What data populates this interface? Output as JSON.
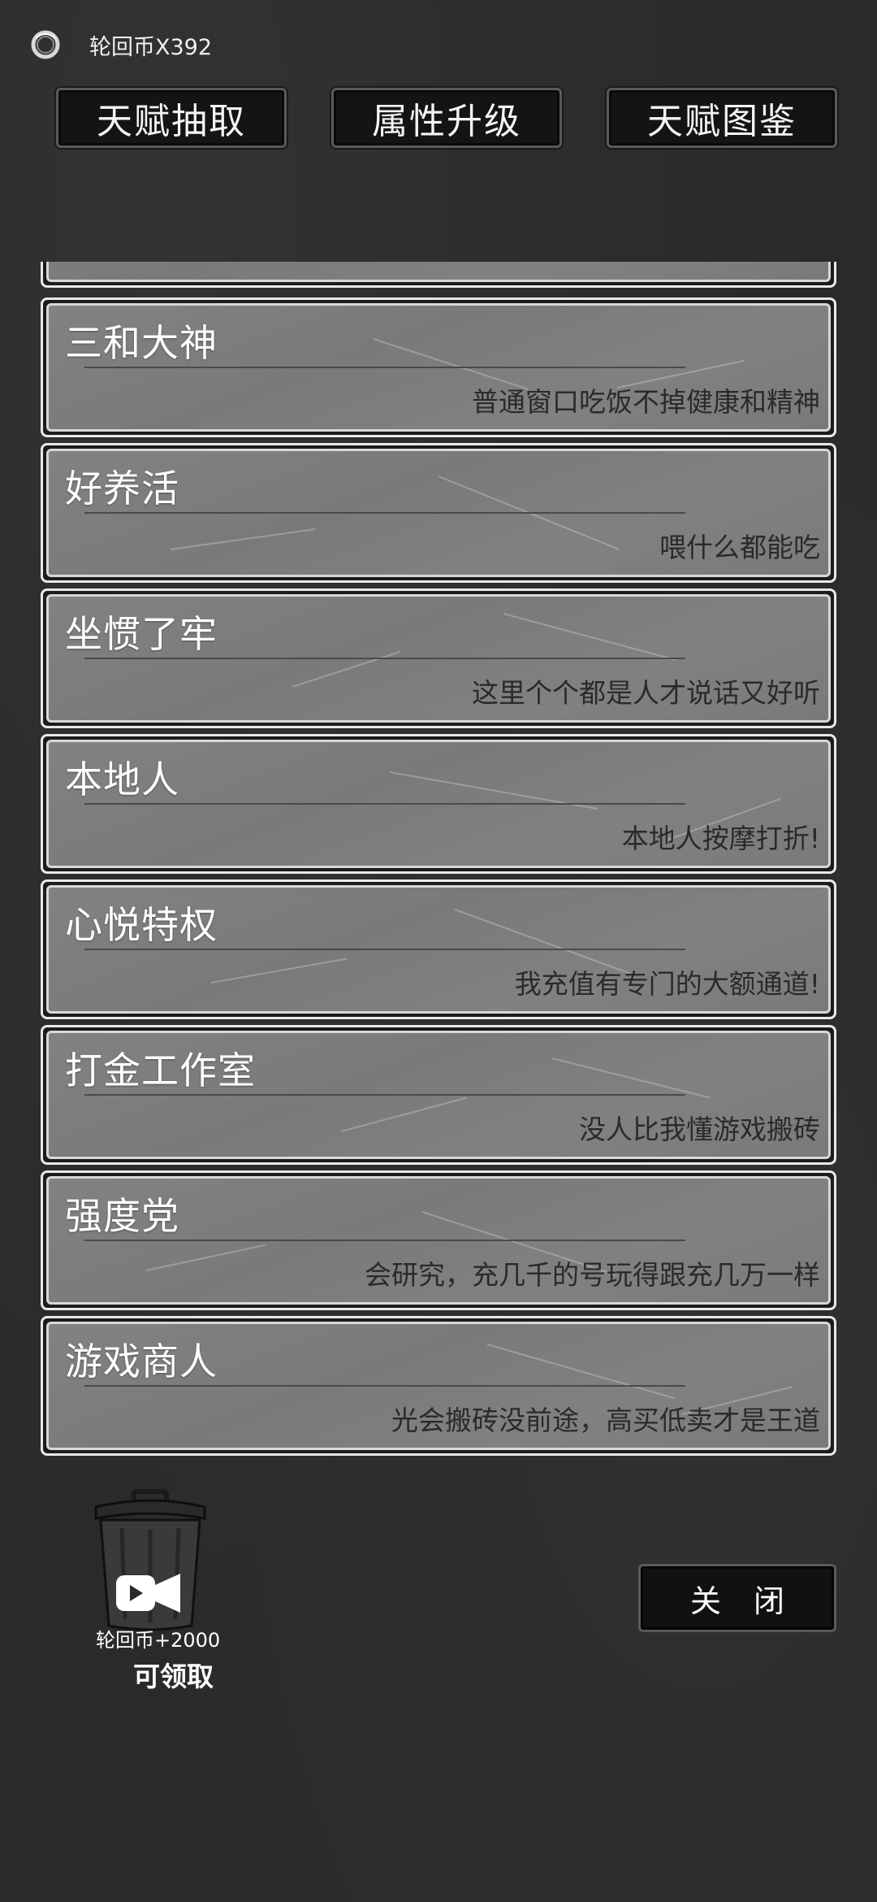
{
  "header": {
    "currency_icon": "ring-icon",
    "currency_text": "轮回币X392"
  },
  "tabs": [
    {
      "label": "天赋抽取"
    },
    {
      "label": "属性升级"
    },
    {
      "label": "天赋图鉴"
    }
  ],
  "talents": [
    {
      "title": "三和大神",
      "desc": "普通窗口吃饭不掉健康和精神"
    },
    {
      "title": "好养活",
      "desc": "喂什么都能吃"
    },
    {
      "title": "坐惯了牢",
      "desc": "这里个个都是人才说话又好听"
    },
    {
      "title": "本地人",
      "desc": "本地人按摩打折!"
    },
    {
      "title": "心悦特权",
      "desc": "我充值有专门的大额通道!"
    },
    {
      "title": "打金工作室",
      "desc": "没人比我懂游戏搬砖"
    },
    {
      "title": "强度党",
      "desc": "会研究，充几千的号玩得跟充几万一样"
    },
    {
      "title": "游戏商人",
      "desc": "光会搬砖没前途，高买低卖才是王道"
    }
  ],
  "bonus": {
    "icon": "trash-can-video-icon",
    "reward": "轮回币+2000",
    "claim": "可领取"
  },
  "footer": {
    "close_label": "关 闭"
  },
  "colors": {
    "background": "#2a2a2a",
    "card": "#7a7a7a",
    "button": "#141414"
  }
}
